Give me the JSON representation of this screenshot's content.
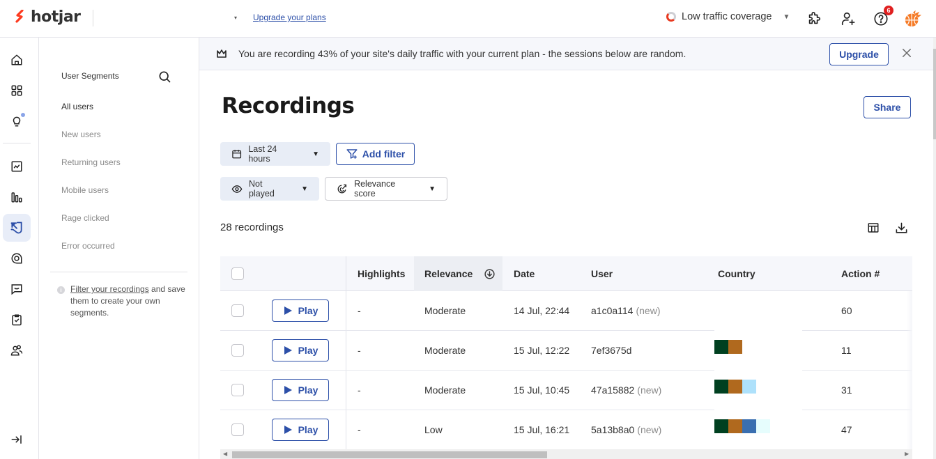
{
  "topbar": {
    "logo_text": "hotjar",
    "upgrade_link": "Upgrade your plans",
    "traffic_label": "Low traffic coverage",
    "help_badge_count": "6",
    "icons": [
      "integrations-icon",
      "invite-user-icon",
      "help-icon",
      "avatar"
    ]
  },
  "rail": {
    "items": [
      {
        "name": "home",
        "icon": "home-icon"
      },
      {
        "name": "dashboard",
        "icon": "grid-icon"
      },
      {
        "name": "insights",
        "icon": "lightbulb-icon",
        "has_dot": true
      },
      {
        "name": "trends",
        "icon": "trend-chart-icon"
      },
      {
        "name": "heatmaps",
        "icon": "bar-chart-icon"
      },
      {
        "name": "recordings",
        "icon": "recordings-icon",
        "active": true
      },
      {
        "name": "feedback",
        "icon": "feedback-icon"
      },
      {
        "name": "surveys",
        "icon": "chat-icon"
      },
      {
        "name": "tasks",
        "icon": "clipboard-check-icon"
      },
      {
        "name": "interviews",
        "icon": "users-icon"
      }
    ],
    "collapse_icon": "collapse-arrow-icon"
  },
  "segments": {
    "title": "User Segments",
    "items": [
      {
        "label": "All users",
        "active": true
      },
      {
        "label": "New users"
      },
      {
        "label": "Returning users"
      },
      {
        "label": "Mobile users"
      },
      {
        "label": "Rage clicked"
      },
      {
        "label": "Error occurred"
      }
    ],
    "info_link": "Filter your recordings",
    "info_text": " and save them to create your own segments."
  },
  "banner": {
    "text": "You are recording 43% of your site's daily traffic with your current plan - the sessions below are random.",
    "upgrade_label": "Upgrade"
  },
  "main": {
    "title": "Recordings",
    "share_label": "Share",
    "filters": {
      "date_range": "Last 24 hours",
      "add_filter": "Add filter",
      "played_status": "Not played",
      "sort_by": "Relevance score"
    },
    "count_label": "28 recordings"
  },
  "table": {
    "columns": [
      "",
      "Highlights",
      "Relevance",
      "Date",
      "User",
      "Country",
      "Action #"
    ],
    "sorted_column": "Relevance",
    "play_label": "Play",
    "rows": [
      {
        "highlights": "-",
        "relevance": "Moderate",
        "date": "14 Jul, 22:44",
        "user": "a1c0a114",
        "is_new": "(new)",
        "flag_colors": [],
        "actions": "60"
      },
      {
        "highlights": "-",
        "relevance": "Moderate",
        "date": "15 Jul, 12:22",
        "user": "7ef3675d",
        "is_new": "",
        "flag_colors": [
          "#004020",
          "#b0691e"
        ],
        "actions": "11"
      },
      {
        "highlights": "-",
        "relevance": "Moderate",
        "date": "15 Jul, 10:45",
        "user": "47a15882",
        "is_new": "(new)",
        "flag_colors": [
          "#004020",
          "#b0691e",
          "#aee1fb"
        ],
        "actions": "31"
      },
      {
        "highlights": "-",
        "relevance": "Low",
        "date": "15 Jul, 16:21",
        "user": "5a13b8a0",
        "is_new": "(new)",
        "flag_colors": [
          "#004020",
          "#b0691e",
          "#3a6fb0",
          "#e6fdfd"
        ],
        "actions": "47"
      }
    ]
  },
  "colors": {
    "brand": "#fd3a1f",
    "accent": "#2c4fa8",
    "badge": "#e02020",
    "avatar": "#f57a26"
  }
}
